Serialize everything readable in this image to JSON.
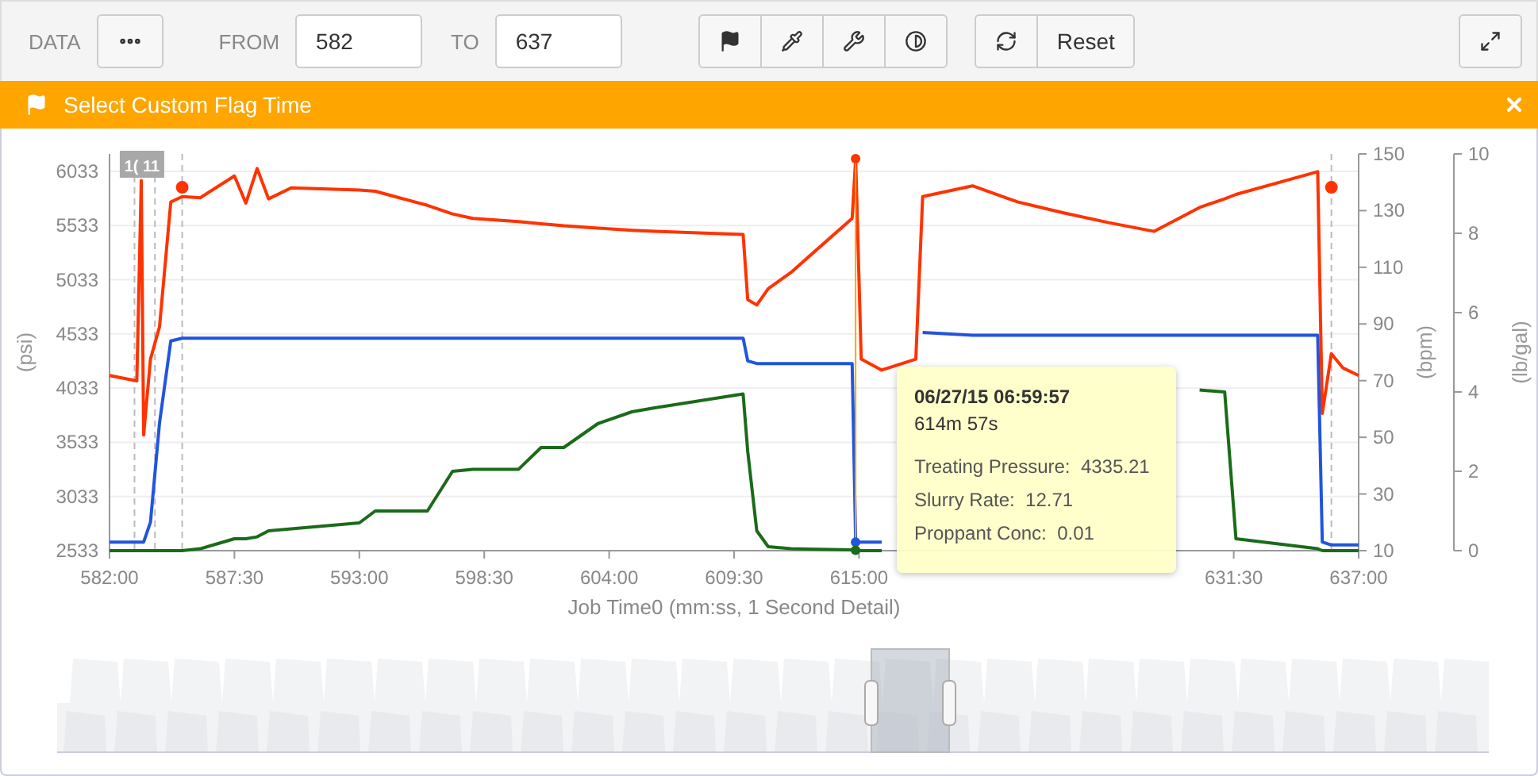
{
  "toolbar": {
    "data_label": "DATA",
    "from_label": "FROM",
    "from_value": "582",
    "to_label": "TO",
    "to_value": "637",
    "reset_label": "Reset"
  },
  "banner": {
    "title": "Select Custom Flag Time"
  },
  "chart": {
    "chart_data": {
      "type": "line",
      "xlabel": "Job Time0 (mm:ss, 1 Second Detail)",
      "ylabel": "(psi)",
      "xlim": [
        582,
        637
      ],
      "ylim": [
        2533,
        6194
      ],
      "y2label": "(bpm)",
      "y2lim": [
        10,
        150
      ],
      "y2ticks": [
        10,
        30,
        50,
        70,
        90,
        110,
        130,
        150
      ],
      "y3label": "(lb/gal)",
      "y3lim": [
        0,
        10
      ],
      "y3ticks": [
        0,
        2,
        4,
        6,
        8,
        10
      ],
      "yticks": [
        2533,
        3033,
        3533,
        4033,
        4533,
        5033,
        5533,
        6033
      ],
      "xticks": [
        {
          "value": 582,
          "label": "582:00"
        },
        {
          "value": 587.5,
          "label": "587:30"
        },
        {
          "value": 593,
          "label": "593:00"
        },
        {
          "value": 598.5,
          "label": "598:30"
        },
        {
          "value": 604,
          "label": "604:00"
        },
        {
          "value": 609.5,
          "label": "609:30"
        },
        {
          "value": 615,
          "label": "615:00"
        },
        {
          "value": 631.5,
          "label": "631:30"
        },
        {
          "value": 637,
          "label": "637:00"
        }
      ],
      "x": [
        582,
        583.2,
        583.4,
        583.5,
        583.8,
        584.2,
        584.7,
        585.2,
        586,
        587.5,
        588,
        588.5,
        589,
        590,
        593,
        593.7,
        596,
        597.1,
        598,
        600,
        601,
        602,
        603.5,
        605,
        606,
        609.9,
        610.1,
        610.5,
        611,
        612,
        614.7,
        614.85,
        615.1,
        616,
        617.5,
        617.8,
        620,
        622,
        624,
        626,
        628,
        630,
        631.1,
        631.6,
        635.2,
        635.4,
        635.8,
        636.3,
        637
      ],
      "grid": true,
      "ref_lines": [
        {
          "axis": "x",
          "value": 614.85,
          "color": "#ffa500"
        }
      ],
      "series": [
        {
          "color": "#ff3300",
          "values": [
            4150,
            4100,
            5950,
            3600,
            4300,
            4600,
            5750,
            5800,
            5790,
            5990,
            5740,
            6060,
            5780,
            5880,
            5860,
            5850,
            5720,
            5640,
            5600,
            5570,
            5550,
            5530,
            5510,
            5490,
            5480,
            5450,
            4850,
            4800,
            4950,
            5100,
            5600,
            6150,
            4300,
            4200,
            4300,
            5800,
            5900,
            5750,
            5650,
            5560,
            5480,
            5700,
            5780,
            5820,
            6030,
            3800,
            4350,
            4220,
            4150
          ]
        },
        {
          "color": "#2255dd",
          "axis": "y2",
          "values": [
            13,
            13,
            13,
            13,
            20,
            55,
            84,
            85,
            85,
            85,
            85,
            85,
            85,
            85,
            85,
            85,
            85,
            85,
            85,
            85,
            85,
            85,
            85,
            85,
            85,
            85,
            77,
            76,
            76,
            76,
            76,
            13,
            13,
            13,
            null,
            87,
            86,
            86,
            86,
            86,
            86,
            86,
            86,
            86,
            86,
            13,
            12,
            12,
            12
          ]
        },
        {
          "color": "#1a6b1a",
          "axis": "y3",
          "values": [
            0,
            0,
            0,
            0,
            0,
            0,
            0,
            0,
            0.05,
            0.3,
            0.3,
            0.35,
            0.5,
            0.55,
            0.7,
            1.0,
            1.0,
            2.0,
            2.05,
            2.05,
            2.6,
            2.6,
            3.2,
            3.5,
            3.6,
            3.95,
            2.5,
            0.5,
            0.1,
            0.05,
            0.02,
            0.01,
            0,
            0,
            null,
            null,
            null,
            null,
            null,
            null,
            null,
            4.05,
            4.0,
            0.3,
            0.05,
            0,
            0,
            0,
            0
          ]
        }
      ],
      "annotations": [
        "1( 11"
      ]
    }
  },
  "tooltip": {
    "title": "06/27/15 06:59:57",
    "subtitle": "614m 57s",
    "rows": [
      {
        "label": "Treating Pressure:",
        "value": "4335.21"
      },
      {
        "label": "Slurry Rate:",
        "value": "12.71"
      },
      {
        "label": "Proppant Conc:",
        "value": "0.01"
      }
    ]
  }
}
